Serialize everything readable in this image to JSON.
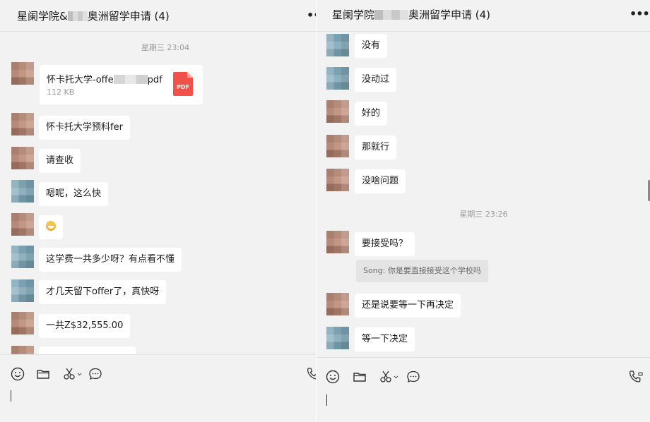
{
  "left": {
    "title_part1": "星阑学院&",
    "title_part2": "奥洲留学申请 (4)",
    "more_icon": "more-dots-icon",
    "time1": "星期三 23:04",
    "file": {
      "name_part1": "怀卡托大学-offe",
      "name_part2": "pdf",
      "size": "112 KB",
      "type_label": "PDF"
    },
    "messages": [
      "怀卡托大学预科fer",
      "请查收",
      "嗯呢，这么快",
      "",
      "这学费一共多少呀？有点看不懂",
      "才几天留下offer了，真快呀",
      "一共Z$32,555.00"
    ]
  },
  "right": {
    "title_part1": "星阑学院",
    "title_part2": "奥洲留学申请 (4)",
    "more_icon": "more-dots-icon",
    "messages_top": [
      "没有",
      "没动过",
      "好的",
      "那就行",
      "没啥问题"
    ],
    "time2": "星期三 23:26",
    "messages_bottom": [
      "要接受吗？",
      "还是说要等一下再决定",
      "等一下决定"
    ],
    "quote": "Song: 你是要直接接受这个学校吗"
  },
  "toolbar_icons": [
    "emoji-icon",
    "folder-icon",
    "scissors-icon",
    "chat-bubble-icon",
    "call-icon"
  ]
}
